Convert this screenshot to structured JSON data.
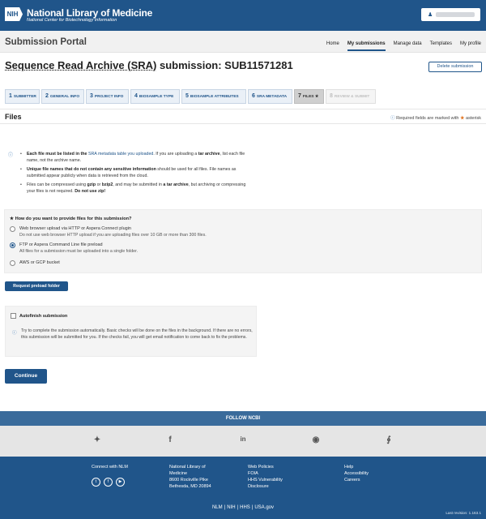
{
  "header": {
    "logo": "NIH",
    "org_name": "National Library of Medicine",
    "org_sub": "National Center for Biotechnology Information",
    "user_icon": "user-icon",
    "user_name": ""
  },
  "portal": {
    "title": "Submission Portal",
    "nav": [
      "Home",
      "My submissions",
      "Manage data",
      "Templates",
      "My profile"
    ],
    "active_nav": "My submissions"
  },
  "submission": {
    "title_prefix": "Sequence Read Archive (SRA)",
    "title_suffix": " submission: SUB11571281",
    "delete_label": "Delete submission"
  },
  "steps": [
    {
      "num": "1",
      "label": "Submitter",
      "state": "done"
    },
    {
      "num": "2",
      "label": "General info",
      "state": "done"
    },
    {
      "num": "3",
      "label": "Project info",
      "state": "done"
    },
    {
      "num": "4",
      "label": "Biosample type",
      "state": "done"
    },
    {
      "num": "5",
      "label": "Biosample attributes",
      "state": "done"
    },
    {
      "num": "6",
      "label": "SRA metadata",
      "state": "done"
    },
    {
      "num": "7",
      "label": "Files ★",
      "state": "current"
    },
    {
      "num": "8",
      "label": "Review & submit",
      "state": "disabled"
    }
  ],
  "files": {
    "title": "Files",
    "required_note": "Required fields are marked with",
    "required_word": "asterisk",
    "bullets": [
      {
        "b1": "Each file must be listed in the ",
        "link": "SRA metadata table you uploaded",
        "b2": ". If you are uploading a ",
        "bold": "tar archive",
        "b3": ", list each file name, not the archive name."
      },
      {
        "bold": "Unique file names that do not contain any sensitive information",
        "b1": " should be used for all files. File names as submitted appear publicly when data is retrieved from the cloud."
      },
      {
        "b1": "Files can be compressed using ",
        "bold1": "gzip",
        "b2": " or ",
        "bold2": "bzip2",
        "b3": ", and may be submitted in ",
        "bold3": "a tar archive",
        "b4": ", but archiving or compressing your files is not required. ",
        "bold4": "Do not use zip!"
      }
    ]
  },
  "provide": {
    "question": "★ How do you want to provide files for this submission?",
    "options": [
      {
        "label": "Web browser upload via HTTP or Aspera Connect plugin",
        "sub": "Do not use web browser HTTP upload if you are uploading files over 10 GB or more than 300 files.",
        "checked": false
      },
      {
        "label": "FTP or Aspera Command Line file preload",
        "sub": "All files for a submission must be uploaded into a single folder.",
        "checked": true
      },
      {
        "label": "AWS or GCP bucket",
        "sub": "",
        "checked": false
      }
    ],
    "preload_button": "Request preload folder"
  },
  "autofinish": {
    "label": "Autofinish submission",
    "text": "Try to complete the submission automatically. Basic checks will be done on the files in the background. If there are no errors, this submission will be submitted for you. If the checks fail, you will get email notification to come back to fix the problems."
  },
  "continue_label": "Continue",
  "footer": {
    "follow": "FOLLOW NCBI",
    "social_icons": [
      "twitter-icon",
      "facebook-icon",
      "linkedin-icon",
      "github-icon",
      "rss-icon"
    ],
    "connect": "Connect with NLM",
    "address": [
      "National Library of",
      "Medicine",
      "8600 Rockville Pike",
      "Bethesda, MD 20894"
    ],
    "policies": [
      "Web Policies",
      "FOIA",
      "HHS Vulnerability",
      "Disclosure"
    ],
    "help": [
      "Help",
      "Accessibility",
      "Careers"
    ],
    "bottom_links": [
      "NLM",
      "NIH",
      "HHS",
      "USA.gov"
    ],
    "last_revision": "Last revision: 1.163.1"
  },
  "colors": {
    "brand": "#20558a",
    "follow_bar": "#3a6b9b",
    "required_star": "#e0701a"
  }
}
